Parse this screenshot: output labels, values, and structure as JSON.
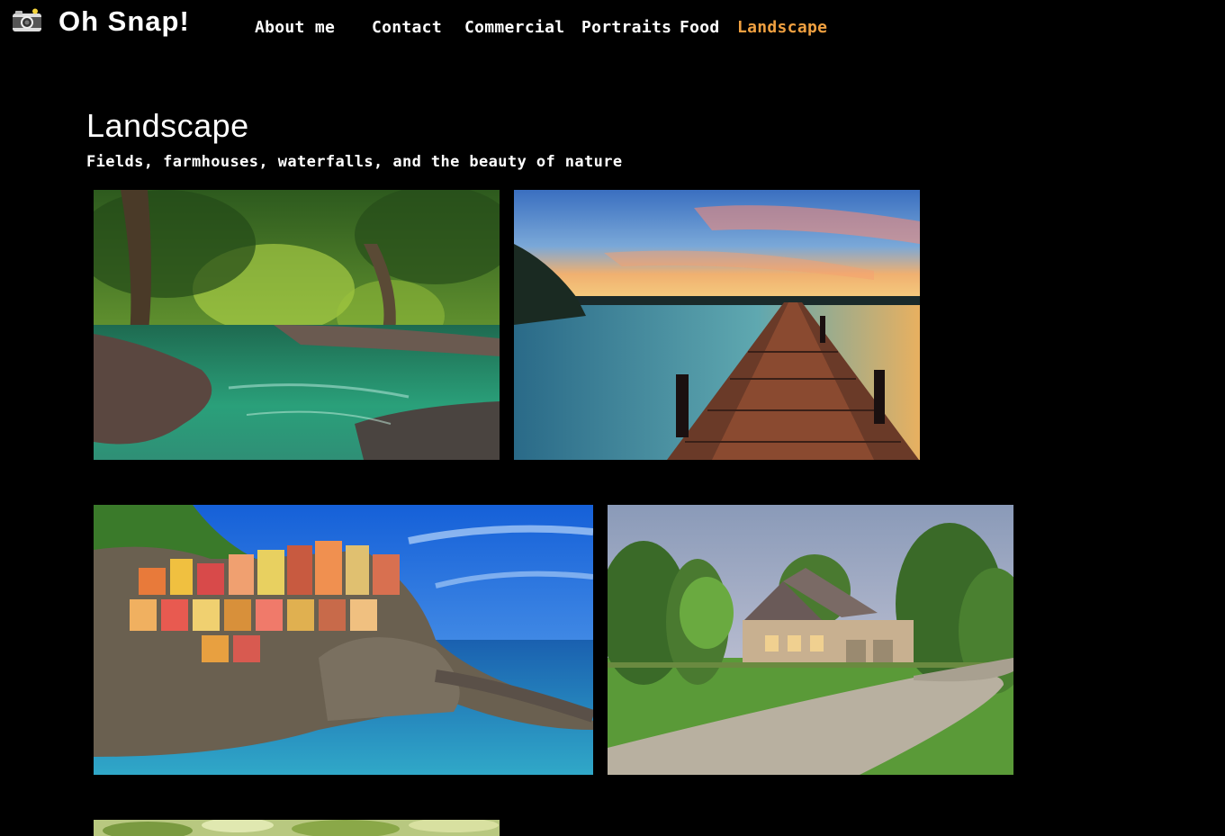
{
  "header": {
    "logo_icon": "camera-icon",
    "site_title": "Oh Snap!"
  },
  "nav": {
    "items": [
      {
        "label": "About me"
      },
      {
        "label": "Contact"
      },
      {
        "label": "Commercial"
      },
      {
        "label": "Portraits"
      },
      {
        "label": "Food"
      },
      {
        "label": "Landscape",
        "active": true
      }
    ],
    "active_color": "#f0a040"
  },
  "main": {
    "title": "Landscape",
    "subtitle": "Fields, farmhouses, waterfalls, and the beauty of nature"
  },
  "gallery": {
    "photos": [
      "forest-river",
      "lake-pier-sunset",
      "cliffside-village",
      "suburban-house"
    ]
  }
}
